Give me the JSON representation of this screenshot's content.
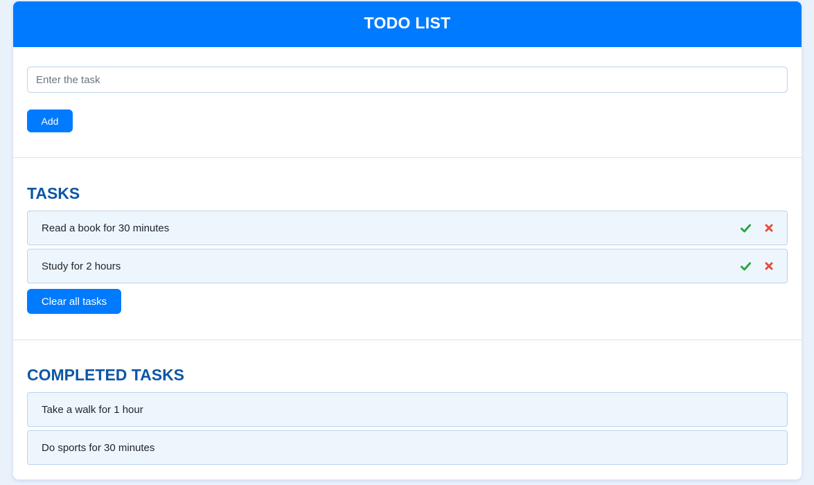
{
  "header": {
    "title": "TODO LIST"
  },
  "input": {
    "placeholder": "Enter the task",
    "value": ""
  },
  "add_button": {
    "label": "Add"
  },
  "tasks": {
    "title": "TASKS",
    "items": [
      {
        "text": "Read a book for 30 minutes"
      },
      {
        "text": "Study for 2 hours"
      }
    ],
    "clear_label": "Clear all tasks"
  },
  "completed": {
    "title": "COMPLETED TASKS",
    "items": [
      {
        "text": "Take a walk for 1 hour"
      },
      {
        "text": "Do sports for 30 minutes"
      }
    ]
  },
  "icons": {
    "complete": "check-icon",
    "delete": "close-icon"
  },
  "colors": {
    "primary": "#007bff",
    "heading": "#0d56a6",
    "item_bg": "#eef6fd",
    "complete_icon": "#28a745",
    "delete_icon": "#e74c3c"
  }
}
